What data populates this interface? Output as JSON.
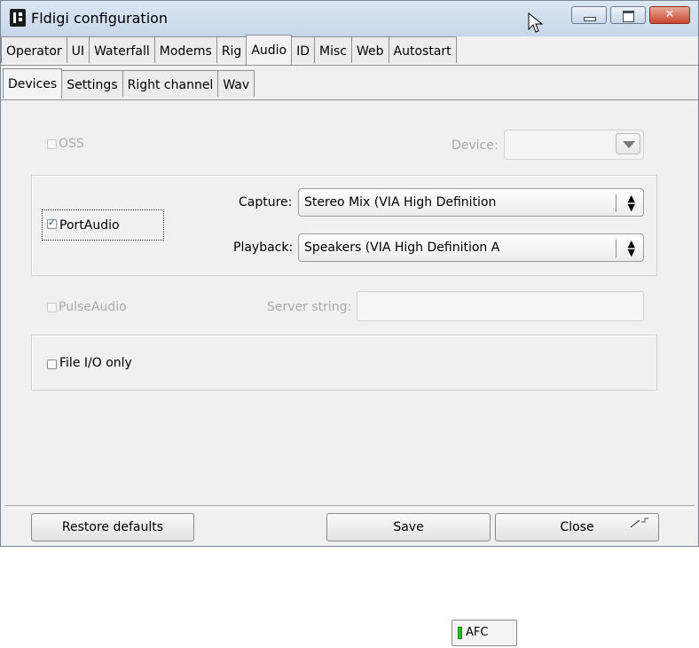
{
  "window": {
    "title": "Fldigi configuration",
    "close_glyph": "✕"
  },
  "tabs_main": [
    "Operator",
    "UI",
    "Waterfall",
    "Modems",
    "Rig",
    "Audio",
    "ID",
    "Misc",
    "Web",
    "Autostart"
  ],
  "tabs_sub": [
    "Devices",
    "Settings",
    "Right channel",
    "Wav"
  ],
  "active_main_tab": "Audio",
  "active_sub_tab": "Devices",
  "devices": {
    "oss": {
      "label": "OSS",
      "checked": false,
      "enabled": false,
      "device_label": "Device:",
      "device_value": ""
    },
    "portaudio": {
      "label": "PortAudio",
      "checked": true,
      "capture_label": "Capture:",
      "capture_value": "Stereo Mix (VIA High Definition",
      "playback_label": "Playback:",
      "playback_value": "Speakers (VIA High Definition A"
    },
    "pulseaudio": {
      "label": "PulseAudio",
      "checked": false,
      "enabled": false,
      "server_label": "Server string:",
      "server_value": ""
    },
    "fileio": {
      "label": "File I/O only",
      "checked": false
    }
  },
  "buttons": {
    "restore": "Restore defaults",
    "save": "Save",
    "close": "Close"
  },
  "afc": {
    "label": "AFC",
    "led_color": "#22c022"
  },
  "icons": {
    "app": "fldigi-app-icon",
    "cursor": "mouse-pointer-icon"
  }
}
